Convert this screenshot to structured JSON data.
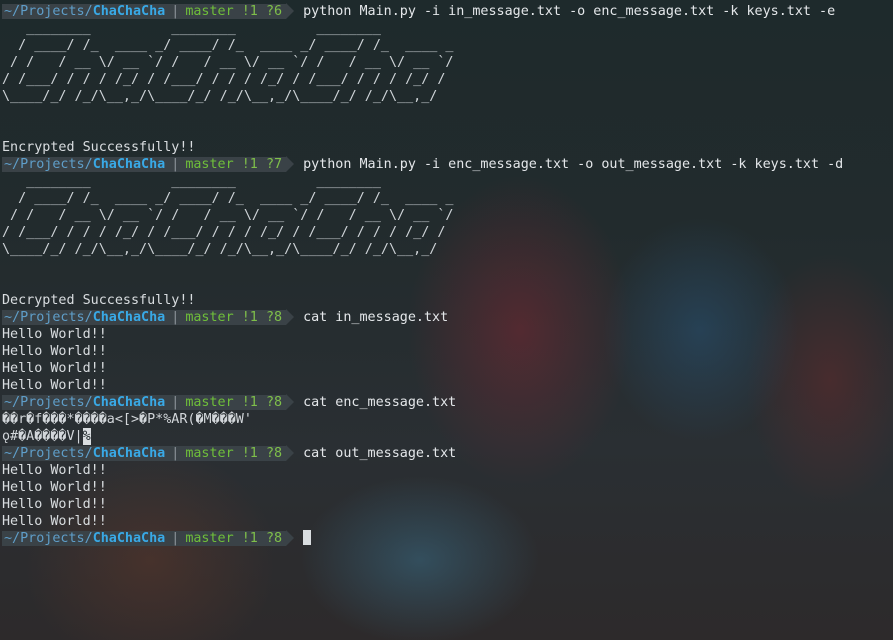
{
  "prompt": {
    "dir": "~/Projects/",
    "repo": "ChaChaCha",
    "separator": "|",
    "branch": "master",
    "dirty": "!1"
  },
  "lines": [
    {
      "type": "prompt",
      "untracked": "?6",
      "cmd": "python Main.py -i in_message.txt -o enc_message.txt -k keys.txt -e"
    },
    {
      "type": "art",
      "text": "   ________          ________          ________"
    },
    {
      "type": "art",
      "text": "  / ____/ /_  ____ _/ ____/ /_  ____ _/ ____/ /_  ____ _"
    },
    {
      "type": "art",
      "text": " / /   / __ \\/ __ `/ /   / __ \\/ __ `/ /   / __ \\/ __ `/"
    },
    {
      "type": "art",
      "text": "/ /___/ / / / /_/ / /___/ / / / /_/ / /___/ / / / /_/ /"
    },
    {
      "type": "art",
      "text": "\\____/_/ /_/\\__,_/\\____/_/ /_/\\__,_/\\____/_/ /_/\\__,_/"
    },
    {
      "type": "text",
      "text": ""
    },
    {
      "type": "text",
      "text": ""
    },
    {
      "type": "text",
      "text": "Encrypted Successfully!!"
    },
    {
      "type": "prompt",
      "untracked": "?7",
      "cmd": "python Main.py -i enc_message.txt -o out_message.txt -k keys.txt -d"
    },
    {
      "type": "art",
      "text": "   ________          ________          ________"
    },
    {
      "type": "art",
      "text": "  / ____/ /_  ____ _/ ____/ /_  ____ _/ ____/ /_  ____ _"
    },
    {
      "type": "art",
      "text": " / /   / __ \\/ __ `/ /   / __ \\/ __ `/ /   / __ \\/ __ `/"
    },
    {
      "type": "art",
      "text": "/ /___/ / / / /_/ / /___/ / / / /_/ / /___/ / / / /_/ /"
    },
    {
      "type": "art",
      "text": "\\____/_/ /_/\\__,_/\\____/_/ /_/\\__,_/\\____/_/ /_/\\__,_/"
    },
    {
      "type": "text",
      "text": ""
    },
    {
      "type": "text",
      "text": ""
    },
    {
      "type": "text",
      "text": "Decrypted Successfully!!"
    },
    {
      "type": "prompt",
      "untracked": "?8",
      "cmd": "cat in_message.txt"
    },
    {
      "type": "text",
      "text": "Hello World!!"
    },
    {
      "type": "text",
      "text": "Hello World!!"
    },
    {
      "type": "text",
      "text": "Hello World!!"
    },
    {
      "type": "text",
      "text": "Hello World!!"
    },
    {
      "type": "prompt",
      "untracked": "?8",
      "cmd": "cat enc_message.txt"
    },
    {
      "type": "garble",
      "text": "��r�f���*����a<[>�P*%AR(�M���W'"
    },
    {
      "type": "garble",
      "text": "ǫ#�A����V|",
      "tail": "%"
    },
    {
      "type": "prompt",
      "untracked": "?8",
      "cmd": "cat out_message.txt"
    },
    {
      "type": "text",
      "text": "Hello World!!"
    },
    {
      "type": "text",
      "text": "Hello World!!"
    },
    {
      "type": "text",
      "text": "Hello World!!"
    },
    {
      "type": "text",
      "text": "Hello World!!"
    },
    {
      "type": "prompt",
      "untracked": "?8",
      "cmd": "",
      "cursor": true
    }
  ]
}
